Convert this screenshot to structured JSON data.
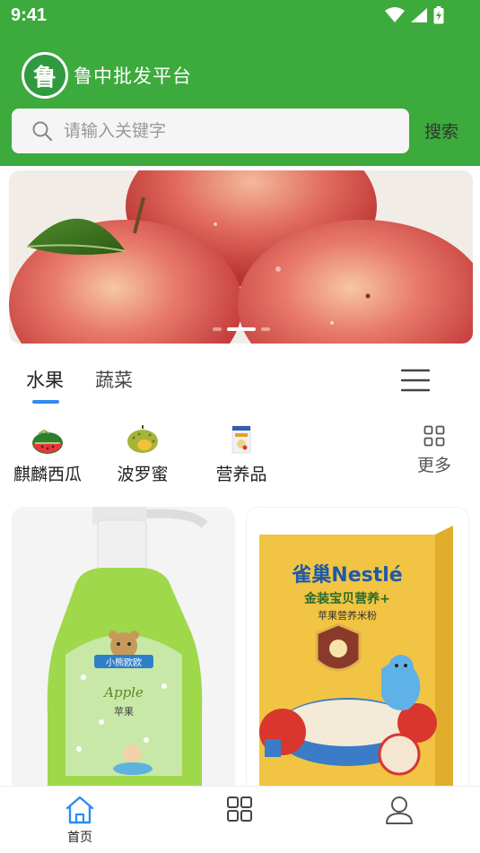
{
  "status_bar": {
    "time": "9:41",
    "icons": [
      "wifi-icon",
      "signal-icon",
      "battery-icon"
    ]
  },
  "header": {
    "logo_char": "鲁",
    "title": "鲁中批发平台",
    "background_color": "#3caa3c"
  },
  "search": {
    "placeholder": "请输入关键字",
    "button_label": "搜索"
  },
  "banner": {
    "image": "apples",
    "slide_count": 3,
    "active_slide": 1
  },
  "tabs": {
    "items": [
      {
        "label": "水果",
        "active": true
      },
      {
        "label": "蔬菜",
        "active": false
      }
    ],
    "indicator_color": "#2d8cf0",
    "menu_icon": "hamburger-menu-icon"
  },
  "categories": {
    "items": [
      {
        "label": "麒麟西瓜",
        "icon": "watermelon-image"
      },
      {
        "label": "波罗蜜",
        "icon": "jackfruit-image"
      },
      {
        "label": "营养品",
        "icon": "nutrition-box-image"
      }
    ],
    "more_label": "更多",
    "more_icon": "grid-icon"
  },
  "products": [
    {
      "image": "apple-baby-wash-bottle",
      "bottle_brand": "小熊欧欧",
      "bottle_text": "Apple",
      "bottle_cn": "苹果"
    },
    {
      "image": "nestle-rice-cereal-box",
      "brand": "雀巢Nestlé",
      "subtitle": "金装宝贝营养+",
      "flavor": "苹果营养米粉"
    }
  ],
  "bottom_nav": {
    "items": [
      {
        "label": "首页",
        "icon": "home-icon",
        "active": true
      },
      {
        "label": "",
        "icon": "category-grid-icon",
        "active": false
      },
      {
        "label": "",
        "icon": "user-icon",
        "active": false
      }
    ],
    "active_color": "#2d8cf0"
  }
}
